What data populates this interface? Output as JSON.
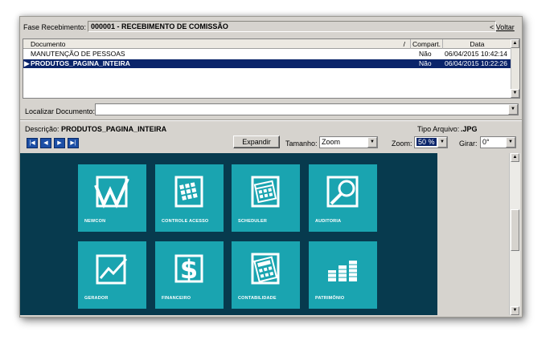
{
  "header": {
    "fase_label": "Fase Recebimento:",
    "fase_value": "000001 - RECEBIMENTO DE COMISSÃO",
    "voltar_prefix": "<",
    "voltar_label": "Voltar"
  },
  "grid": {
    "columns": [
      "Documento",
      "Compart.",
      "Data"
    ],
    "sort_indicator": "/",
    "rows": [
      {
        "documento": "MANUTENÇÃO DE PESSOAS",
        "compart": "Não",
        "data": "06/04/2015 10:42:14"
      },
      {
        "documento": "PRODUTOS_PAGINA_INTEIRA",
        "compart": "Não",
        "data": "06/04/2015 10:22:26"
      }
    ]
  },
  "localizar": {
    "label": "Localizar Documento:",
    "value": ""
  },
  "details": {
    "descricao_label": "Descrição:",
    "descricao_value": "PRODUTOS_PAGINA_INTEIRA",
    "tipo_label": "Tipo Arquivo:",
    "tipo_value": ".JPG"
  },
  "toolbar": {
    "expandir_label": "Expandir",
    "tamanho_label": "Tamanho:",
    "tamanho_value": "Zoom",
    "zoom_label": "Zoom:",
    "zoom_value": "50 %",
    "girar_label": "Girar:",
    "girar_value": "0°"
  },
  "tiles": [
    {
      "label": "NEWCON",
      "icon": "newcon-icon"
    },
    {
      "label": "CONTROLE ACESSO",
      "icon": "access-keypad-icon"
    },
    {
      "label": "SCHEDULER",
      "icon": "calendar-icon"
    },
    {
      "label": "AUDITORIA",
      "icon": "magnifier-icon"
    },
    {
      "label": "GERADOR",
      "icon": "chart-icon"
    },
    {
      "label": "FINANCEIRO",
      "icon": "dollar-icon"
    },
    {
      "label": "CONTABILIDADE",
      "icon": "calculator-icon"
    },
    {
      "label": "PATRIMÔNIO",
      "icon": "coins-icon"
    }
  ],
  "colors": {
    "selection": "#0a246a",
    "viewer_bg": "#073a4e",
    "tile": "#1aa4b0",
    "nav_button": "#1c4fa6"
  }
}
